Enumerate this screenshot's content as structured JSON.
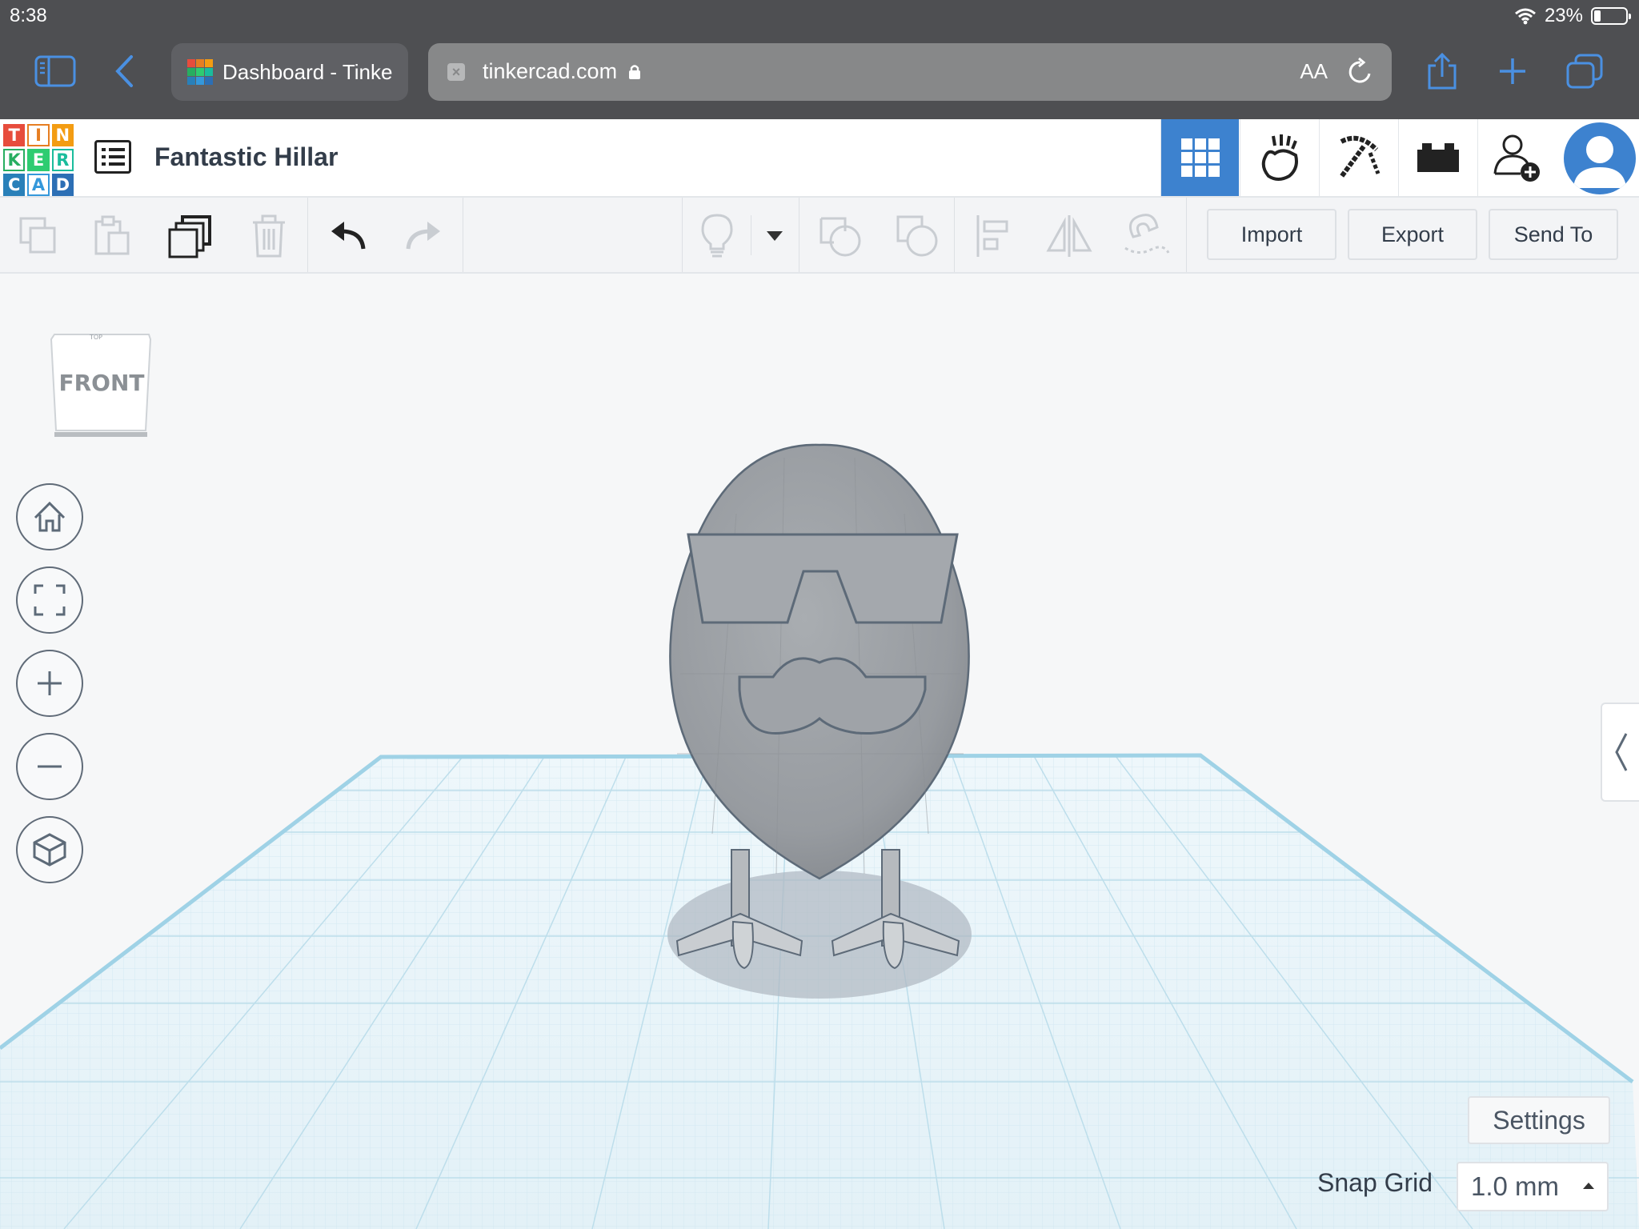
{
  "status_bar": {
    "time": "8:38",
    "battery": "23%"
  },
  "browser": {
    "tab_title": "Dashboard - Tinke",
    "url": "tinkercad.com",
    "text_size_label": "AA"
  },
  "app": {
    "logo_letters": [
      "T",
      "I",
      "N",
      "K",
      "E",
      "R",
      "C",
      "A",
      "D"
    ],
    "project_title": "Fantastic Hillar",
    "header_icons": [
      "3d-design-grid-icon",
      "codeblocks-hand-icon",
      "minecraft-pickaxe-icon",
      "lego-brick-icon",
      "invite-user-icon",
      "user-avatar-icon"
    ]
  },
  "toolbar": {
    "import_label": "Import",
    "export_label": "Export",
    "send_to_label": "Send To"
  },
  "workplane": {
    "view_cube_label": "FRONT",
    "settings_label": "Settings",
    "snap_grid_label": "Snap Grid",
    "snap_grid_value": "1.0 mm"
  },
  "colors": {
    "accent_blue": "#3d82cf",
    "ios_bar": "#4e4f52",
    "logo_t": "#e74c3c",
    "logo_i": "#e67e22",
    "logo_n": "#f39c12",
    "logo_k": "#27ae60",
    "logo_e": "#2ecc71",
    "logo_r": "#1abc9c",
    "logo_c": "#2980b9",
    "logo_a": "#3498db",
    "logo_d": "#2c6fb5"
  }
}
